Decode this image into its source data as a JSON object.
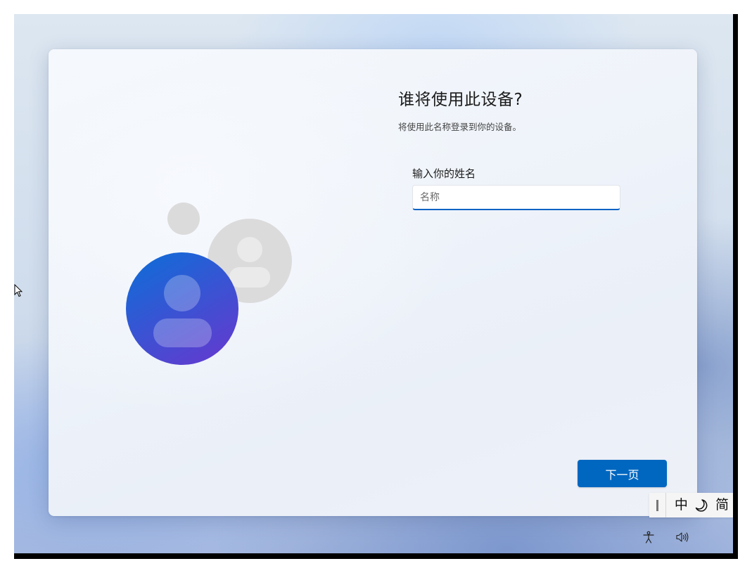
{
  "setup": {
    "title": "谁将使用此设备?",
    "subtitle": "将使用此名称登录到你的设备。",
    "name_field": {
      "label": "输入你的姓名",
      "placeholder": "名称",
      "value": ""
    },
    "next_button_label": "下一页"
  },
  "ime_bar": {
    "mode_label": "中",
    "half_full_width_icon": "moon-icon",
    "script_label": "简"
  },
  "tray": {
    "icons": [
      "accessibility-icon",
      "volume-icon"
    ]
  },
  "colors": {
    "accent": "#0067c0",
    "input_underline": "#0a63c4",
    "avatar_front_top": "#0b6fd8",
    "avatar_front_bottom": "#5b3fd0",
    "avatar_back": "#dcdbdc"
  }
}
